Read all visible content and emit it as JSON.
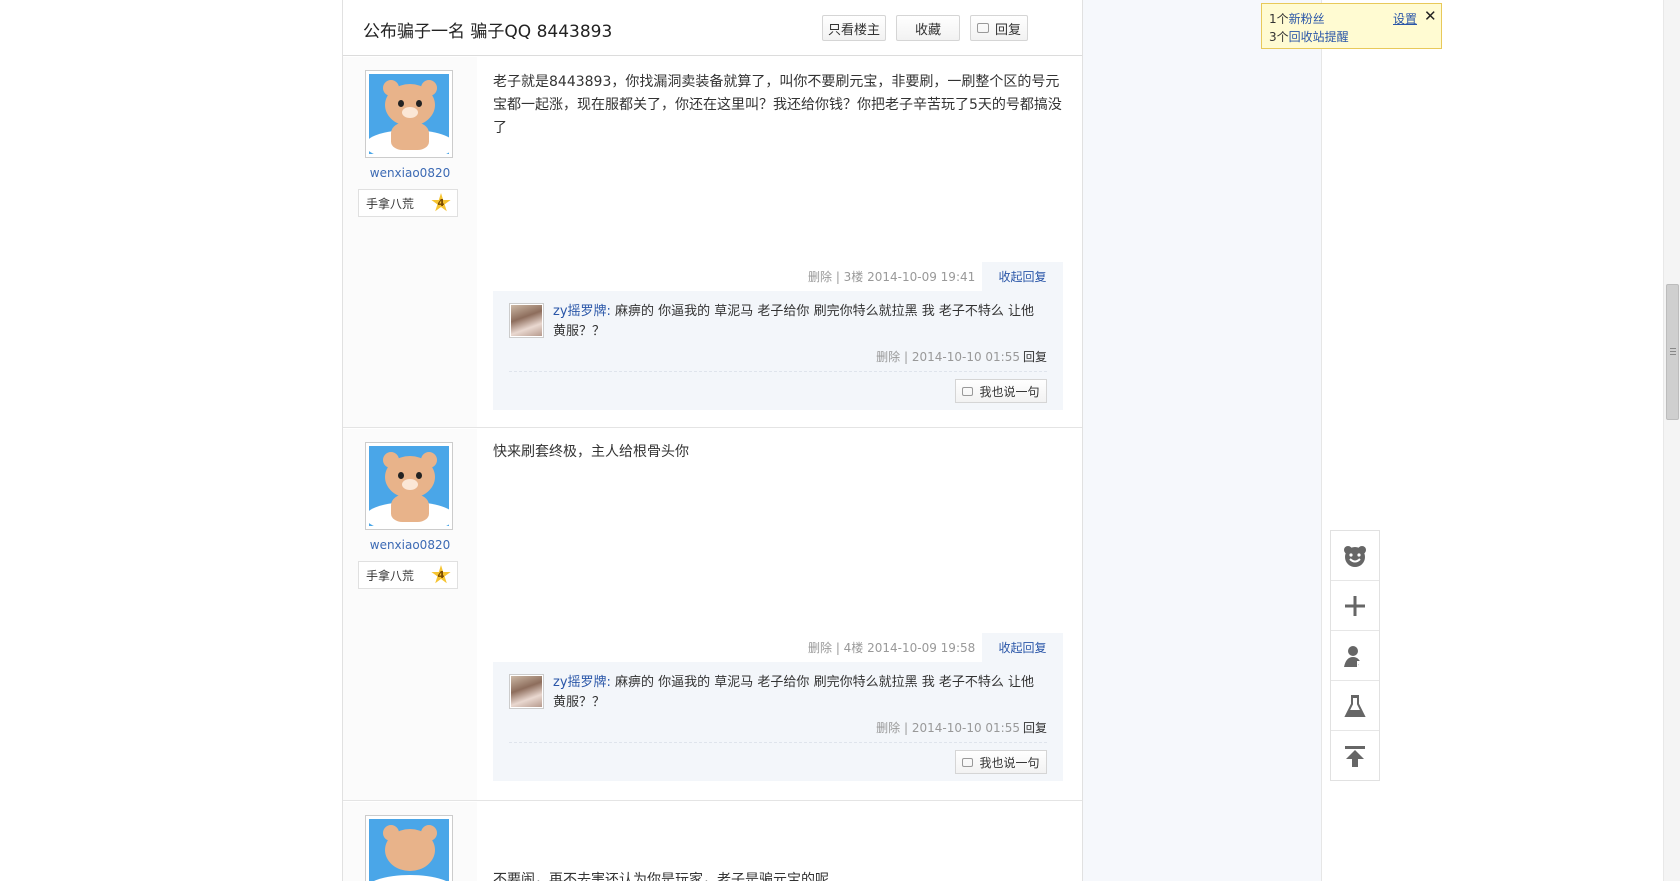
{
  "thread": {
    "title": "公布骗子一名 骗子QQ 8443893",
    "btn_only_op": "只看楼主",
    "btn_collect": "收藏",
    "btn_reply": "回复"
  },
  "posts": [
    {
      "username": "wenxiao0820",
      "rank_label": "手拿八荒",
      "rank_level": "4",
      "content": "老子就是8443893，你找漏洞卖装备就算了，叫你不要刷元宝，非要刷，一刷整个区的号元宝都一起涨，现在服都关了，你还在这里叫？我还给你钱？你把老子辛苦玩了5天的号都搞没了",
      "meta": "删除 |  3楼  2014-10-09 19:41",
      "fold_label": "收起回复",
      "sub_reply": {
        "name": "zy摇罗牌:",
        "text": " 麻痹的 你逼我的 草泥马 老子给你 刷完你特么就拉黑 我 老子不特么 让他黄服？？",
        "meta": "删除 | 2014-10-10 01:55",
        "reply_label": "回复"
      },
      "say_label": "我也说一句"
    },
    {
      "username": "wenxiao0820",
      "rank_label": "手拿八荒",
      "rank_level": "4",
      "content": "快来刷套终极，主人给根骨头你",
      "meta": "删除 |  4楼  2014-10-09 19:58",
      "fold_label": "收起回复",
      "sub_reply": {
        "name": "zy摇罗牌:",
        "text": " 麻痹的 你逼我的 草泥马 老子给你 刷完你特么就拉黑 我 老子不特么 让他黄服？？",
        "meta": "删除 | 2014-10-10 01:55",
        "reply_label": "回复"
      },
      "say_label": "我也说一句"
    },
    {
      "content": "不要闹，再不去害还认为你是玩家，老子是骗元宝的呢"
    }
  ],
  "notify": {
    "fans_count": "1个",
    "fans_label": "新粉丝",
    "recycle_count": "3个",
    "recycle_label": "回收站提醒",
    "settings_label": "设置",
    "close_label": "✕"
  },
  "side_tools": [
    "bear-face-icon",
    "plus-icon",
    "user-icon",
    "flask-icon",
    "back-to-top-icon"
  ]
}
